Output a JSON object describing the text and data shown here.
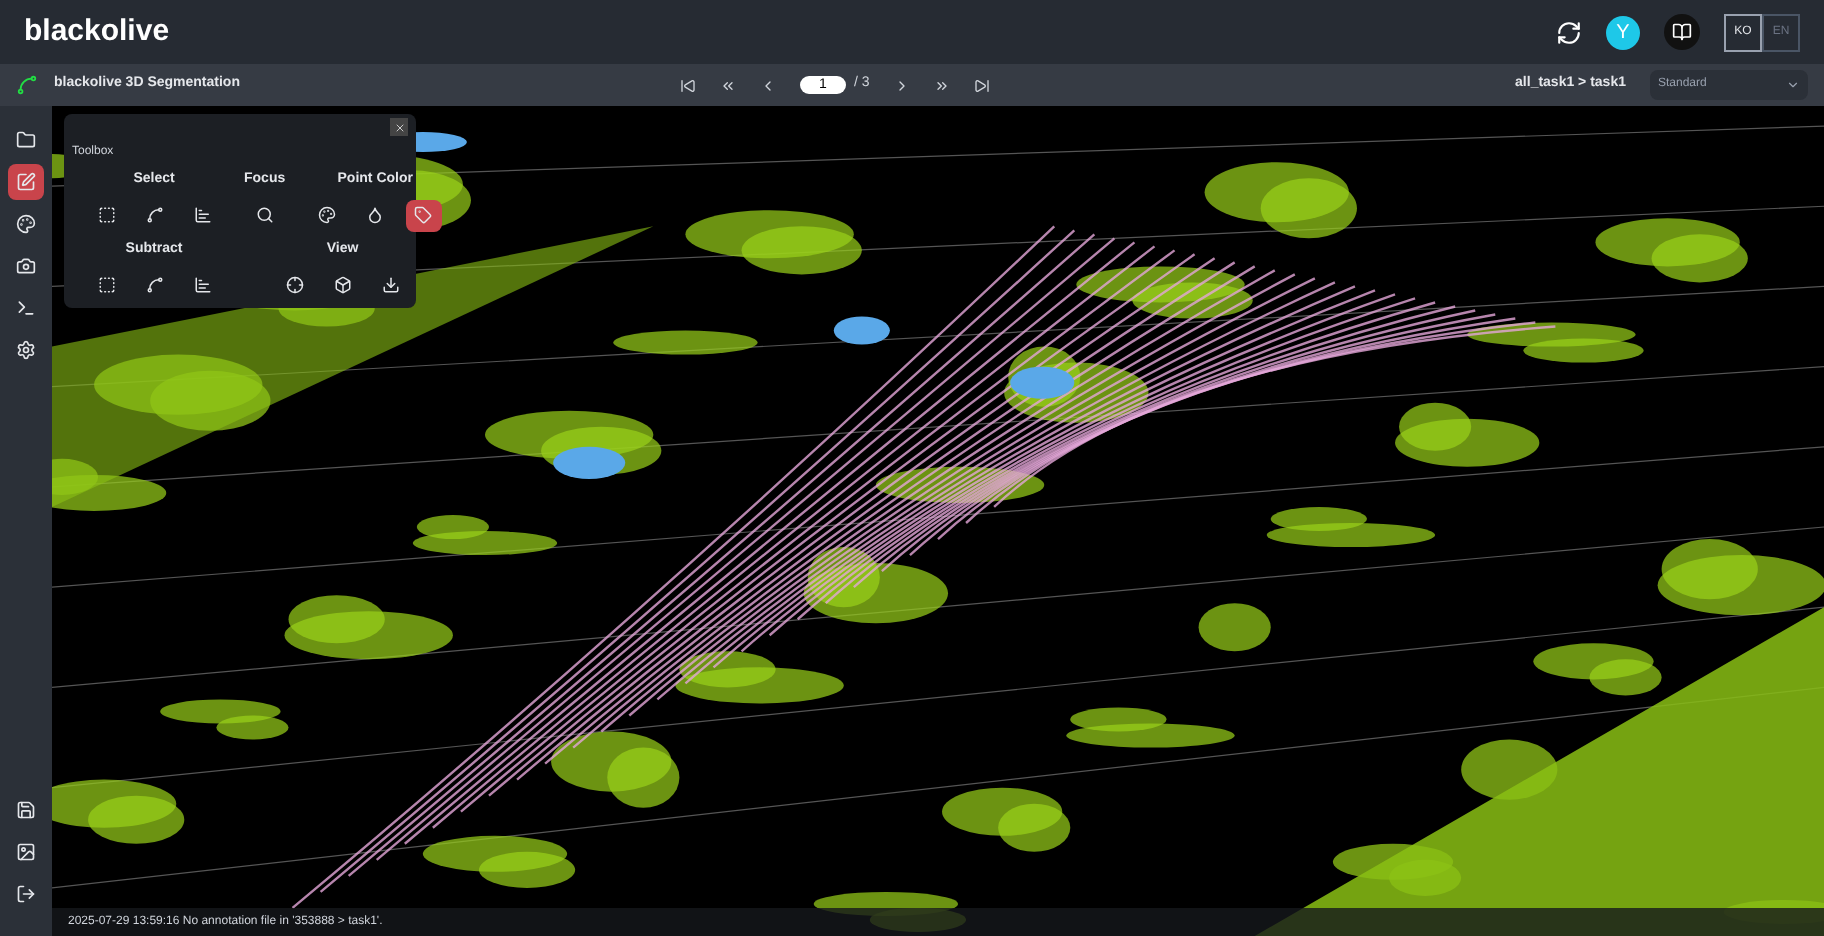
{
  "header": {
    "logo": "blackolive",
    "avatar": "Y",
    "languages": [
      {
        "label": "KO",
        "selected": true
      },
      {
        "label": "EN",
        "selected": false
      }
    ]
  },
  "toolbar": {
    "title": "blackolive 3D Segmentation",
    "page": "1",
    "page_total": "/ 3",
    "breadcrumb": "all_task1 > task1",
    "view_mode": "Standard"
  },
  "sidebar": {
    "items": [
      {
        "kind": "folder",
        "selected": false
      },
      {
        "kind": "edit",
        "selected": true
      },
      {
        "kind": "palette",
        "selected": false
      },
      {
        "kind": "camera",
        "selected": false
      },
      {
        "kind": "terminal",
        "selected": false
      },
      {
        "kind": "settings",
        "selected": false
      }
    ],
    "bottom_items": [
      {
        "kind": "save",
        "selected": false
      },
      {
        "kind": "image",
        "selected": false
      },
      {
        "kind": "logout",
        "selected": false
      }
    ]
  },
  "toolbox": {
    "title": "Toolbox",
    "groups": [
      {
        "label": "Select",
        "tools": [
          {
            "kind": "box",
            "selected": false
          },
          {
            "kind": "polygon",
            "selected": false
          },
          {
            "kind": "bars",
            "selected": false
          }
        ]
      },
      {
        "label": "Focus",
        "tools": [
          {
            "kind": "search",
            "selected": false
          }
        ]
      },
      {
        "label": "Point Color",
        "tools": [
          {
            "kind": "palette",
            "selected": false
          },
          {
            "kind": "drop",
            "selected": false
          },
          {
            "kind": "tag",
            "selected": true
          }
        ]
      },
      {
        "label": "Subtract",
        "tools": [
          {
            "kind": "box",
            "selected": false
          },
          {
            "kind": "polygon",
            "selected": false
          },
          {
            "kind": "bars",
            "selected": false
          }
        ]
      },
      {
        "label": "View",
        "tools": [
          {
            "kind": "crosshair",
            "selected": false
          },
          {
            "kind": "cube",
            "selected": false
          },
          {
            "kind": "download",
            "selected": false
          }
        ]
      }
    ]
  },
  "status_message": "2025-07-29 13:59:16 No annotation file in '353888 > task1'."
}
